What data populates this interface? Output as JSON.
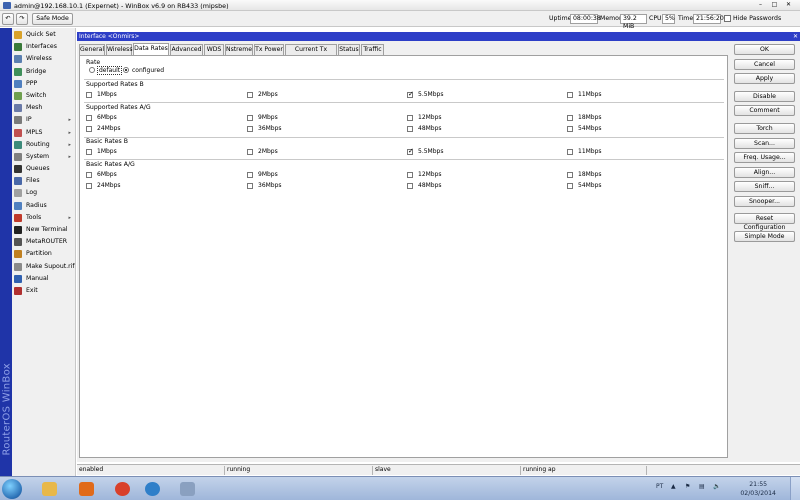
{
  "titlebar": {
    "title": "admin@192.168.10.1 (Expernet) - WinBox v6.9 on RB433 (mipsbe)"
  },
  "toolbar": {
    "safe_mode": "Safe Mode",
    "uptime_label": "Uptime:",
    "uptime": "08:00:38",
    "memory_label": "Memory:",
    "memory": "39.2 MiB",
    "cpu_label": "CPU:",
    "cpu": "5%",
    "time_label": "Time:",
    "time": "21:56:20",
    "hide_passwords": "Hide Passwords"
  },
  "brand": "RouterOS WinBox",
  "sidebar": {
    "items": [
      {
        "label": "Quick Set",
        "icon": "quickset-icon",
        "color": "#d9a22a",
        "arrow": false
      },
      {
        "label": "Interfaces",
        "icon": "interfaces-icon",
        "color": "#3a7a3a",
        "arrow": false
      },
      {
        "label": "Wireless",
        "icon": "wireless-icon",
        "color": "#5a7fb0",
        "arrow": false
      },
      {
        "label": "Bridge",
        "icon": "bridge-icon",
        "color": "#3f8f5a",
        "arrow": false
      },
      {
        "label": "PPP",
        "icon": "ppp-icon",
        "color": "#4f7fbf",
        "arrow": false
      },
      {
        "label": "Switch",
        "icon": "switch-icon",
        "color": "#6f9f4f",
        "arrow": false
      },
      {
        "label": "Mesh",
        "icon": "mesh-icon",
        "color": "#6a7aa8",
        "arrow": false
      },
      {
        "label": "IP",
        "icon": "ip-icon",
        "color": "#7a7a7a",
        "arrow": true
      },
      {
        "label": "MPLS",
        "icon": "mpls-icon",
        "color": "#c05050",
        "arrow": true
      },
      {
        "label": "Routing",
        "icon": "routing-icon",
        "color": "#3c8a7a",
        "arrow": true
      },
      {
        "label": "System",
        "icon": "system-icon",
        "color": "#808080",
        "arrow": true
      },
      {
        "label": "Queues",
        "icon": "queues-icon",
        "color": "#333333",
        "arrow": false
      },
      {
        "label": "Files",
        "icon": "files-icon",
        "color": "#4a68a8",
        "arrow": false
      },
      {
        "label": "Log",
        "icon": "log-icon",
        "color": "#a0a0a0",
        "arrow": false
      },
      {
        "label": "Radius",
        "icon": "radius-icon",
        "color": "#5080c0",
        "arrow": false
      },
      {
        "label": "Tools",
        "icon": "tools-icon",
        "color": "#c0392b",
        "arrow": true
      },
      {
        "label": "New Terminal",
        "icon": "terminal-icon",
        "color": "#222222",
        "arrow": false
      },
      {
        "label": "MetaROUTER",
        "icon": "metarouter-icon",
        "color": "#555555",
        "arrow": false
      },
      {
        "label": "Partition",
        "icon": "partition-icon",
        "color": "#c08020",
        "arrow": false
      },
      {
        "label": "Make Supout.rif",
        "icon": "supout-icon",
        "color": "#8a8a8a",
        "arrow": false
      },
      {
        "label": "Manual",
        "icon": "manual-icon",
        "color": "#3060b0",
        "arrow": false
      },
      {
        "label": "Exit",
        "icon": "exit-icon",
        "color": "#b03030",
        "arrow": false
      }
    ]
  },
  "window": {
    "title": "Interface <Onmirs>",
    "tabs": [
      "General",
      "Wireless",
      "Data Rates",
      "Advanced",
      "WDS",
      "Nstreme",
      "Tx Power",
      "Current Tx Power",
      "Status",
      "Traffic"
    ],
    "active_tab": "Data Rates",
    "rate": {
      "title": "Rate",
      "options": [
        {
          "label": "default",
          "selected": false
        },
        {
          "label": "configured",
          "selected": true
        }
      ]
    },
    "supported_b": {
      "title": "Supported Rates B",
      "rates": [
        {
          "label": "1Mbps",
          "checked": false
        },
        {
          "label": "2Mbps",
          "checked": false
        },
        {
          "label": "5.5Mbps",
          "checked": true
        },
        {
          "label": "11Mbps",
          "checked": false
        }
      ]
    },
    "supported_ag": {
      "title": "Supported Rates A/G",
      "rates": [
        {
          "label": "6Mbps",
          "checked": false
        },
        {
          "label": "9Mbps",
          "checked": false
        },
        {
          "label": "12Mbps",
          "checked": false
        },
        {
          "label": "18Mbps",
          "checked": false
        },
        {
          "label": "24Mbps",
          "checked": false
        },
        {
          "label": "36Mbps",
          "checked": false
        },
        {
          "label": "48Mbps",
          "checked": false
        },
        {
          "label": "54Mbps",
          "checked": false
        }
      ]
    },
    "basic_b": {
      "title": "Basic Rates B",
      "rates": [
        {
          "label": "1Mbps",
          "checked": false
        },
        {
          "label": "2Mbps",
          "checked": false
        },
        {
          "label": "5.5Mbps",
          "checked": true
        },
        {
          "label": "11Mbps",
          "checked": false
        }
      ]
    },
    "basic_ag": {
      "title": "Basic Rates A/G",
      "rates": [
        {
          "label": "6Mbps",
          "checked": false
        },
        {
          "label": "9Mbps",
          "checked": false
        },
        {
          "label": "12Mbps",
          "checked": false
        },
        {
          "label": "18Mbps",
          "checked": false
        },
        {
          "label": "24Mbps",
          "checked": false
        },
        {
          "label": "36Mbps",
          "checked": false
        },
        {
          "label": "48Mbps",
          "checked": false
        },
        {
          "label": "54Mbps",
          "checked": false
        }
      ]
    },
    "buttons": [
      "OK",
      "Cancel",
      "Apply",
      "Disable",
      "Comment",
      "Torch",
      "Scan...",
      "Freq. Usage...",
      "Align...",
      "Sniff...",
      "Snooper...",
      "Reset Configuration",
      "Simple Mode"
    ],
    "status": [
      "enabled",
      "running",
      "slave",
      "running ap"
    ]
  },
  "taskbar": {
    "apps": [
      {
        "name": "explorer-icon",
        "color": "#e8b84a"
      },
      {
        "name": "media-player-icon",
        "color": "#e06a1a"
      },
      {
        "name": "chrome-icon",
        "color": "#d9402b"
      },
      {
        "name": "winbox-icon",
        "color": "#2f7fc9"
      },
      {
        "name": "paint-icon",
        "color": "#8aa0c0"
      }
    ],
    "lang": "PT",
    "clock_time": "21:55",
    "clock_date": "02/03/2014"
  }
}
